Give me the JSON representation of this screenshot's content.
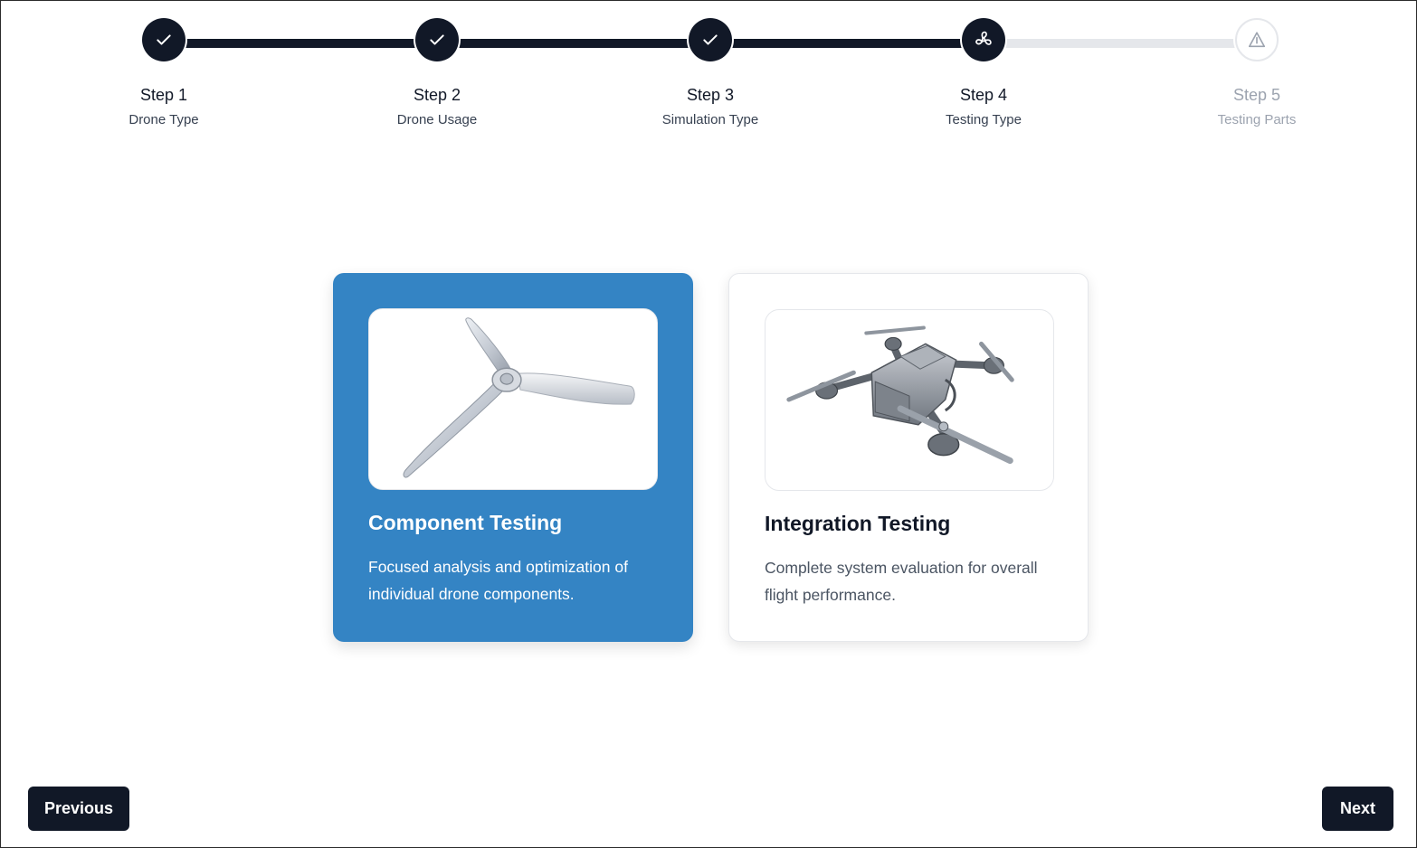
{
  "colors": {
    "dark": "#111827",
    "selected_card": "#3484c4",
    "pending": "#9ca3af",
    "track_todo": "#e5e7eb"
  },
  "stepper": {
    "steps": [
      {
        "title": "Step 1",
        "subtitle": "Drone Type",
        "status": "done",
        "icon": "check-icon"
      },
      {
        "title": "Step 2",
        "subtitle": "Drone Usage",
        "status": "done",
        "icon": "check-icon"
      },
      {
        "title": "Step 3",
        "subtitle": "Simulation Type",
        "status": "done",
        "icon": "check-icon"
      },
      {
        "title": "Step 4",
        "subtitle": "Testing Type",
        "status": "current",
        "icon": "fan-icon"
      },
      {
        "title": "Step 5",
        "subtitle": "Testing Parts",
        "status": "pending",
        "icon": "triangle-alert-icon"
      }
    ]
  },
  "options": [
    {
      "title": "Component Testing",
      "description": "Focused analysis and optimization of individual drone components.",
      "image": "propeller-image",
      "selected": true
    },
    {
      "title": "Integration Testing",
      "description": "Complete system evaluation for overall flight performance.",
      "image": "drone-image",
      "selected": false
    }
  ],
  "nav": {
    "previous_label": "Previous",
    "next_label": "Next"
  }
}
